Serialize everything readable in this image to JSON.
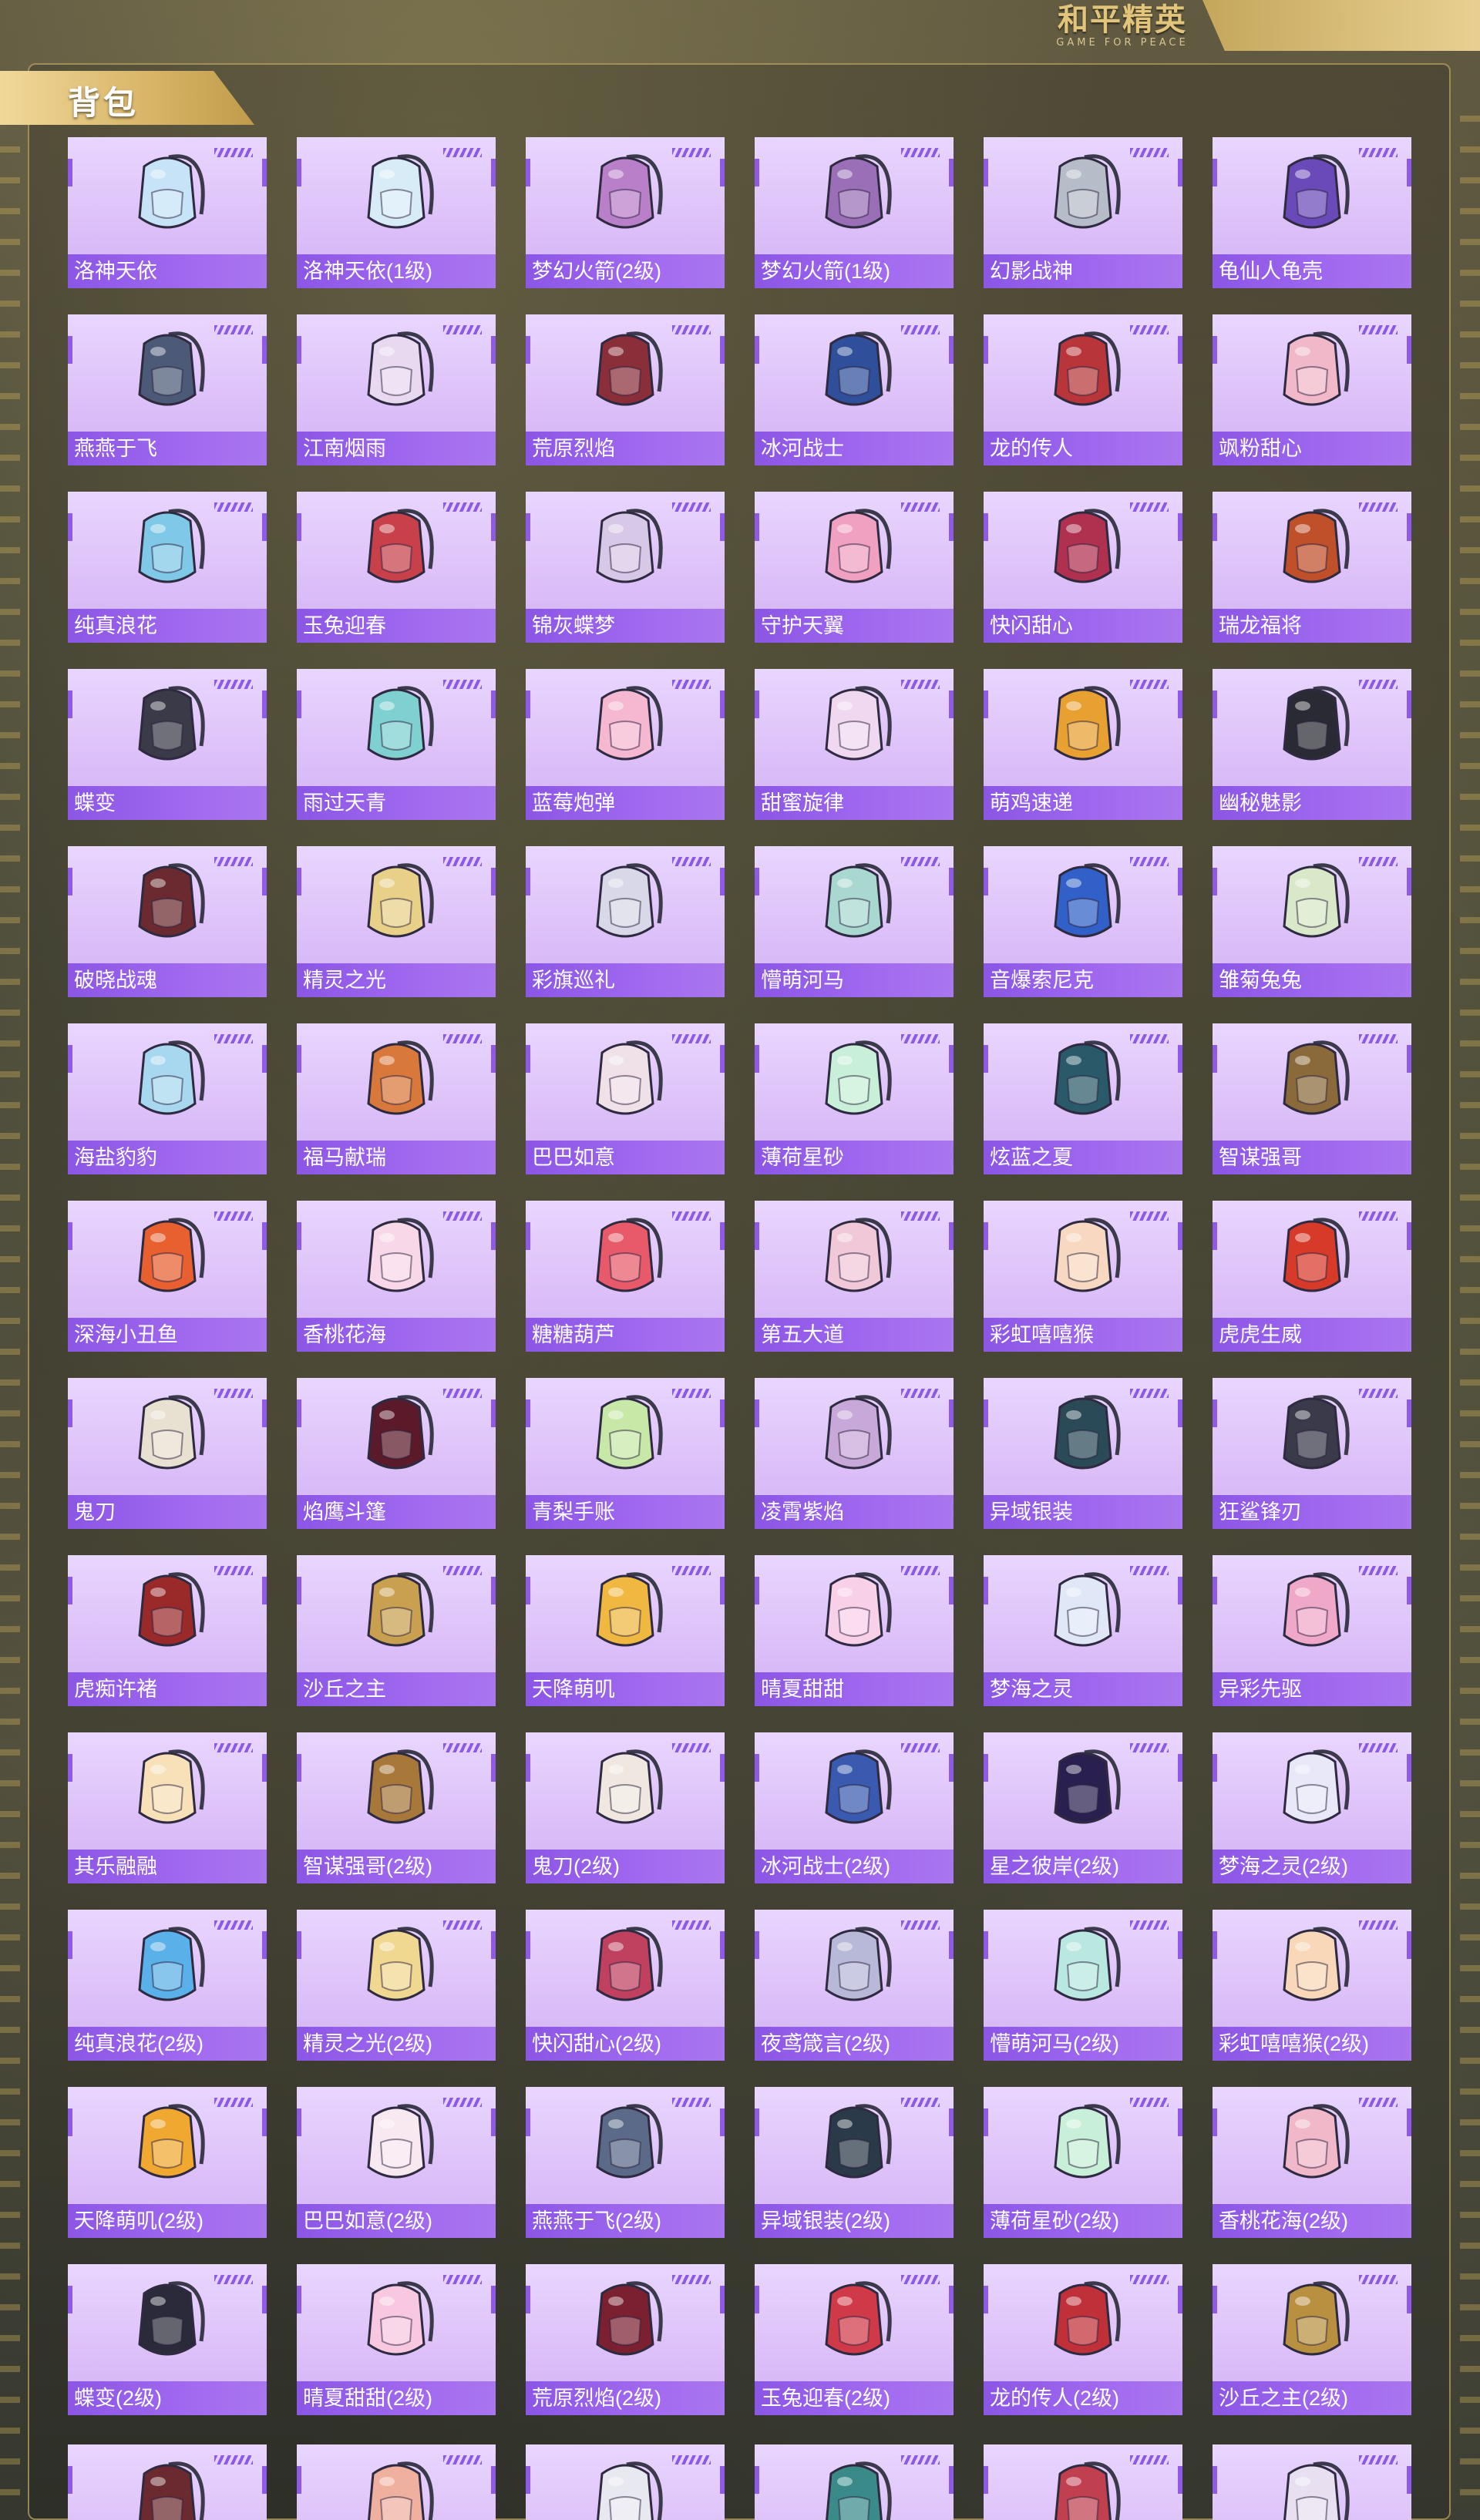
{
  "logo": {
    "main": "和平精英",
    "sub": "GAME FOR PEACE"
  },
  "section": {
    "title": "背包"
  },
  "items": [
    {
      "name": "洛神天依",
      "color": "#c7e3f7"
    },
    {
      "name": "洛神天依(1级)",
      "color": "#d8ecf8"
    },
    {
      "name": "梦幻火箭(2级)",
      "color": "#b97fc9"
    },
    {
      "name": "梦幻火箭(1级)",
      "color": "#9a6fb8"
    },
    {
      "name": "幻影战神",
      "color": "#b6bcc8"
    },
    {
      "name": "龟仙人龟壳",
      "color": "#6a4ab8"
    },
    {
      "name": "燕燕于飞",
      "color": "#4c5a78"
    },
    {
      "name": "江南烟雨",
      "color": "#e8d8f0"
    },
    {
      "name": "荒原烈焰",
      "color": "#8a2f3a"
    },
    {
      "name": "冰河战士",
      "color": "#2f4f9a"
    },
    {
      "name": "龙的传人",
      "color": "#b8363a"
    },
    {
      "name": "飒粉甜心",
      "color": "#f0b8c8"
    },
    {
      "name": "纯真浪花",
      "color": "#7fc8e8"
    },
    {
      "name": "玉兔迎春",
      "color": "#c8404a"
    },
    {
      "name": "锦灰蝶梦",
      "color": "#d8c8e8"
    },
    {
      "name": "守护天翼",
      "color": "#f0a0c0"
    },
    {
      "name": "快闪甜心",
      "color": "#b03050"
    },
    {
      "name": "瑞龙福将",
      "color": "#c0502a"
    },
    {
      "name": "蝶变",
      "color": "#3a3a48"
    },
    {
      "name": "雨过天青",
      "color": "#7fd0d0"
    },
    {
      "name": "蓝莓炮弹",
      "color": "#f5b8d0"
    },
    {
      "name": "甜蜜旋律",
      "color": "#f0d8f0"
    },
    {
      "name": "萌鸡速递",
      "color": "#e8a030"
    },
    {
      "name": "幽秘魅影",
      "color": "#2a2a34"
    },
    {
      "name": "破晓战魂",
      "color": "#6a2a30"
    },
    {
      "name": "精灵之光",
      "color": "#e8d088"
    },
    {
      "name": "彩旗巡礼",
      "color": "#d8d8e8"
    },
    {
      "name": "懵萌河马",
      "color": "#a8d8d0"
    },
    {
      "name": "音爆索尼克",
      "color": "#3060c8"
    },
    {
      "name": "雏菊兔兔",
      "color": "#d8e8c8"
    },
    {
      "name": "海盐豹豹",
      "color": "#a8d8f0"
    },
    {
      "name": "福马献瑞",
      "color": "#d8783a"
    },
    {
      "name": "巴巴如意",
      "color": "#f0e0e8"
    },
    {
      "name": "薄荷星砂",
      "color": "#c8f0d8"
    },
    {
      "name": "炫蓝之夏",
      "color": "#2a5a6a"
    },
    {
      "name": "智谋强哥",
      "color": "#8a6a3a"
    },
    {
      "name": "深海小丑鱼",
      "color": "#e86030"
    },
    {
      "name": "香桃花海",
      "color": "#f8d8e8"
    },
    {
      "name": "糖糖葫芦",
      "color": "#e85a6a"
    },
    {
      "name": "第五大道",
      "color": "#f0c8d8"
    },
    {
      "name": "彩虹嘻嘻猴",
      "color": "#f8d8c0"
    },
    {
      "name": "虎虎生威",
      "color": "#d83a2a"
    },
    {
      "name": "鬼刀",
      "color": "#e8e0d0"
    },
    {
      "name": "焰鹰斗篷",
      "color": "#5a1a2a"
    },
    {
      "name": "青梨手账",
      "color": "#c8e8a8"
    },
    {
      "name": "凌霄紫焰",
      "color": "#c8a8d8"
    },
    {
      "name": "异域银装",
      "color": "#2a4a58"
    },
    {
      "name": "狂鲨锋刃",
      "color": "#3a3a4a"
    },
    {
      "name": "虎痴许褚",
      "color": "#9a2a2a"
    },
    {
      "name": "沙丘之主",
      "color": "#c8a050"
    },
    {
      "name": "天降萌叽",
      "color": "#f0b840"
    },
    {
      "name": "晴夏甜甜",
      "color": "#f8d0e8"
    },
    {
      "name": "梦海之灵",
      "color": "#e0e8f8"
    },
    {
      "name": "异彩先驱",
      "color": "#f0a8c8"
    },
    {
      "name": "其乐融融",
      "color": "#f8e0b8"
    },
    {
      "name": "智谋强哥(2级)",
      "color": "#a8783a"
    },
    {
      "name": "鬼刀(2级)",
      "color": "#f0e8e0"
    },
    {
      "name": "冰河战士(2级)",
      "color": "#3a5ab0"
    },
    {
      "name": "星之彼岸(2级)",
      "color": "#2a2050"
    },
    {
      "name": "梦海之灵(2级)",
      "color": "#e8e8f8"
    },
    {
      "name": "纯真浪花(2级)",
      "color": "#5ab0e8"
    },
    {
      "name": "精灵之光(2级)",
      "color": "#f0d890"
    },
    {
      "name": "快闪甜心(2级)",
      "color": "#c04060"
    },
    {
      "name": "夜鸢箴言(2级)",
      "color": "#b8b8d8"
    },
    {
      "name": "懵萌河马(2级)",
      "color": "#b8e8e0"
    },
    {
      "name": "彩虹嘻嘻猴(2级)",
      "color": "#f8d8b8"
    },
    {
      "name": "天降萌叽(2级)",
      "color": "#f0a830"
    },
    {
      "name": "巴巴如意(2级)",
      "color": "#f8e8f0"
    },
    {
      "name": "燕燕于飞(2级)",
      "color": "#5a6a88"
    },
    {
      "name": "异域银装(2级)",
      "color": "#2a3a48"
    },
    {
      "name": "薄荷星砂(2级)",
      "color": "#c8f0d8"
    },
    {
      "name": "香桃花海(2级)",
      "color": "#f0b8c8"
    },
    {
      "name": "蝶变(2级)",
      "color": "#2a2a3a"
    },
    {
      "name": "晴夏甜甜(2级)",
      "color": "#f8c8e0"
    },
    {
      "name": "荒原烈焰(2级)",
      "color": "#7a2030"
    },
    {
      "name": "玉兔迎春(2级)",
      "color": "#d03a48"
    },
    {
      "name": "龙的传人(2级)",
      "color": "#c03038"
    },
    {
      "name": "沙丘之主(2级)",
      "color": "#b89040"
    }
  ],
  "partial_items": [
    {
      "color": "#6a2a30"
    },
    {
      "color": "#f0b0a0"
    },
    {
      "color": "#e8e8f0"
    },
    {
      "color": "#3a8a8a"
    },
    {
      "color": "#c04050"
    },
    {
      "color": "#e8e0f0"
    }
  ]
}
